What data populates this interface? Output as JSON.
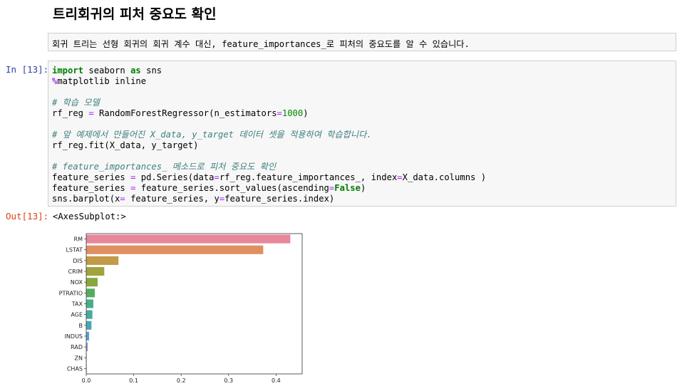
{
  "heading": "트리회귀의 피처 중요도 확인",
  "markdown": "회귀 트리는 선형 회귀의 회귀 계수 대신, feature_importances_로 피처의 중요도를 알 수 있습니다.",
  "input_prompt": "In [13]:",
  "output_prompt": "Out[13]:",
  "code": {
    "l1": {
      "kw1": "import",
      "t1": " seaborn ",
      "kw2": "as",
      "t2": " sns"
    },
    "l2": {
      "mg": "%",
      "t": "matplotlib inline"
    },
    "l4": "# 학습 모델",
    "l5": {
      "a": "rf_reg ",
      "eq": "=",
      "b": " RandomForestRegressor(n_estimators",
      "eq2": "=",
      "num": "1000",
      "c": ")"
    },
    "l7": "# 앞 예제에서 만들어진 X_data, y_target 데이터 셋을 적용하여 학습합니다.",
    "l8": "rf_reg.fit(X_data, y_target)",
    "l10": "# feature_importances_ 메소드로 피처 중요도 확인",
    "l11": {
      "a": "feature_series ",
      "eq": "=",
      "b": " pd.Series(data",
      "eq2": "=",
      "c": "rf_reg.feature_importances_, index",
      "eq3": "=",
      "d": "X_data.columns )"
    },
    "l12": {
      "a": "feature_series ",
      "eq": "=",
      "b": " feature_series.sort_values(ascending",
      "eq2": "=",
      "kw": "False",
      "c": ")"
    },
    "l13": {
      "a": "sns.barplot(x",
      "eq": "=",
      "b": " feature_series, y",
      "eq2": "=",
      "c": "feature_series.index)"
    }
  },
  "output_text": "<AxesSubplot:>",
  "chart_data": {
    "type": "bar",
    "orientation": "horizontal",
    "categories": [
      "RM",
      "LSTAT",
      "DIS",
      "CRIM",
      "NOX",
      "PTRATIO",
      "TAX",
      "AGE",
      "B",
      "INDUS",
      "RAD",
      "ZN",
      "CHAS"
    ],
    "values": [
      0.43,
      0.373,
      0.068,
      0.038,
      0.024,
      0.018,
      0.015,
      0.013,
      0.011,
      0.006,
      0.003,
      0.001,
      0.001
    ],
    "colors": [
      "#e8869a",
      "#e08f62",
      "#c29a49",
      "#a2a23e",
      "#86a83f",
      "#53ad5d",
      "#4aae8a",
      "#4aaa9f",
      "#4aa6b4",
      "#5aa0cf",
      "#8e8fdc",
      "#c47bd8",
      "#de72bd"
    ],
    "xlim": [
      0,
      0.455
    ],
    "xticks": [
      "0.0",
      "0.1",
      "0.2",
      "0.3",
      "0.4"
    ],
    "xtick_values": [
      0,
      0.1,
      0.2,
      0.3,
      0.4
    ],
    "title": "",
    "xlabel": "",
    "ylabel": "",
    "grid": false
  }
}
